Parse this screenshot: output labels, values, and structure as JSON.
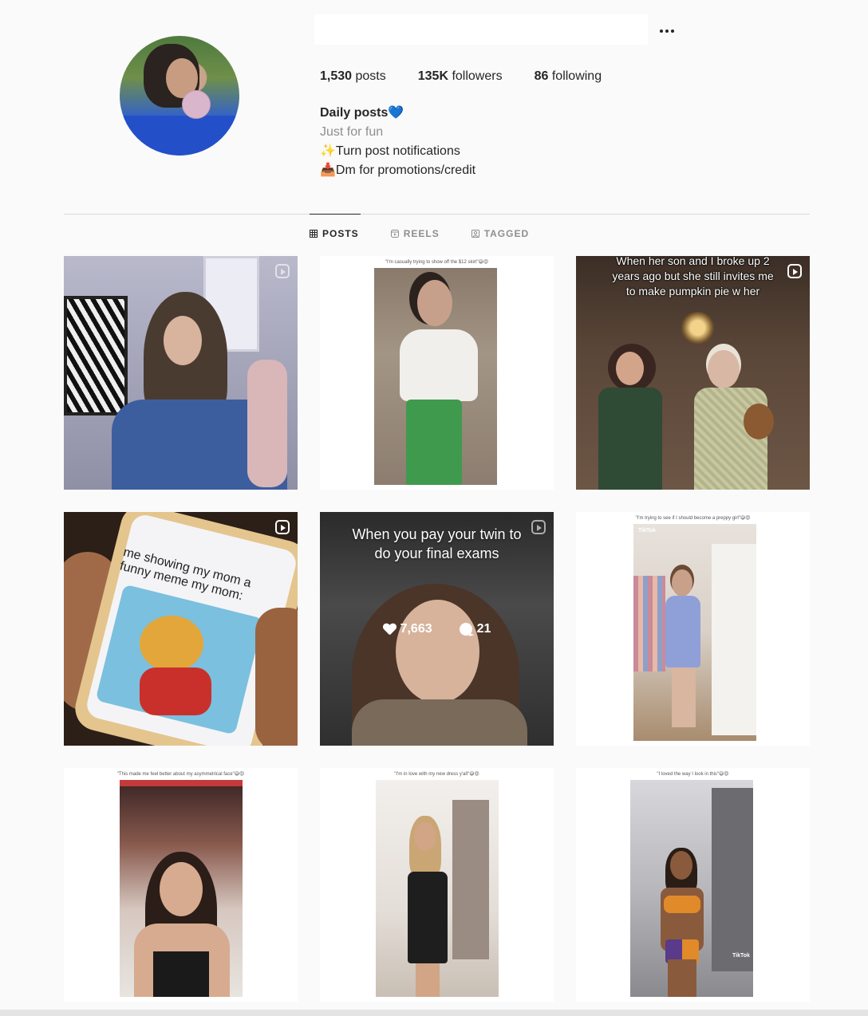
{
  "profile": {
    "stats": {
      "posts_count": "1,530",
      "posts_label": "posts",
      "followers_count": "135K",
      "followers_label": "followers",
      "following_count": "86",
      "following_label": "following"
    },
    "bio": {
      "name": "Daily posts💙",
      "category": "Just for fun",
      "line1": "✨Turn post notifications",
      "line2": "📥Dm for promotions/credit"
    }
  },
  "tabs": [
    {
      "label": "POSTS",
      "icon": "grid-icon",
      "active": true
    },
    {
      "label": "REELS",
      "icon": "reels-icon",
      "active": false
    },
    {
      "label": "TAGGED",
      "icon": "tagged-icon",
      "active": false
    }
  ],
  "posts": [
    {
      "reel": true
    },
    {
      "caption": "\"I'm casually trying to show off the $12 skirt\"😅😍"
    },
    {
      "reel": true,
      "overlay": "When her son and I broke up 2 years ago but she still invites me to make pumpkin pie w her"
    },
    {
      "reel": true,
      "overlay": "me showing my mom a funny meme my mom:"
    },
    {
      "reel": true,
      "overlay": "When you pay your twin to do your final exams",
      "likes": "7,663",
      "comments": "21"
    },
    {
      "caption": "\"I'm trying to see if I should become a preppy girl\"😅😍",
      "watermark": "TikTok"
    },
    {
      "caption": "\"This made me feel better about my asymmetrical face\"😅😍"
    },
    {
      "caption": "\"I'm in love with my new dress y'all\"😅😍"
    },
    {
      "caption": "\"I loved the way I look in this\"😅😍",
      "watermark": "TikTok"
    }
  ],
  "colors": {
    "text": "#262626",
    "muted": "#8e8e8e",
    "divider": "#dbdbdb",
    "bg": "#fafafa"
  }
}
